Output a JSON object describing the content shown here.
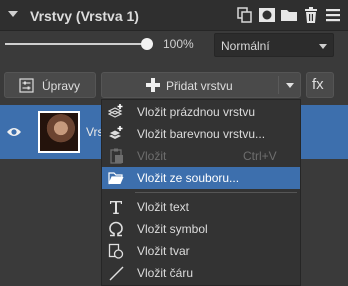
{
  "panel": {
    "title": "Vrstvy (Vrstva 1)",
    "header_icons": [
      "duplicate-icon",
      "mask-icon",
      "folder-icon",
      "trash-icon",
      "menu-icon"
    ]
  },
  "opacity": {
    "value_label": "100%",
    "value": 100
  },
  "blend_mode": {
    "selected": "Normální"
  },
  "buttons": {
    "edits_label": "Úpravy",
    "add_layer_label": "Přidat vrstvu",
    "fx_label": "fx"
  },
  "layer": {
    "name_partial": "Vrs",
    "visible": true
  },
  "menu": {
    "items": [
      {
        "label": "Vložit prázdnou vrstvu",
        "icon": "new-layer-icon",
        "shortcut": "",
        "disabled": false,
        "highlighted": false
      },
      {
        "label": "Vložit barevnou vrstvu...",
        "icon": "color-layer-icon",
        "shortcut": "",
        "disabled": false,
        "highlighted": false
      },
      {
        "label": "Vložit",
        "icon": "paste-icon",
        "shortcut": "Ctrl+V",
        "disabled": true,
        "highlighted": false
      },
      {
        "label": "Vložit ze souboru...",
        "icon": "open-folder-icon",
        "shortcut": "",
        "disabled": false,
        "highlighted": true
      },
      {
        "label": "Vložit text",
        "icon": "text-icon",
        "shortcut": "",
        "disabled": false,
        "highlighted": false
      },
      {
        "label": "Vložit symbol",
        "icon": "omega-icon",
        "shortcut": "",
        "disabled": false,
        "highlighted": false
      },
      {
        "label": "Vložit tvar",
        "icon": "shape-icon",
        "shortcut": "",
        "disabled": false,
        "highlighted": false
      },
      {
        "label": "Vložit čáru",
        "icon": "line-icon",
        "shortcut": "",
        "disabled": false,
        "highlighted": false
      }
    ]
  },
  "colors": {
    "highlight": "#3d6fad",
    "panel_bg": "#3a3a3a",
    "menu_bg": "#333333"
  }
}
